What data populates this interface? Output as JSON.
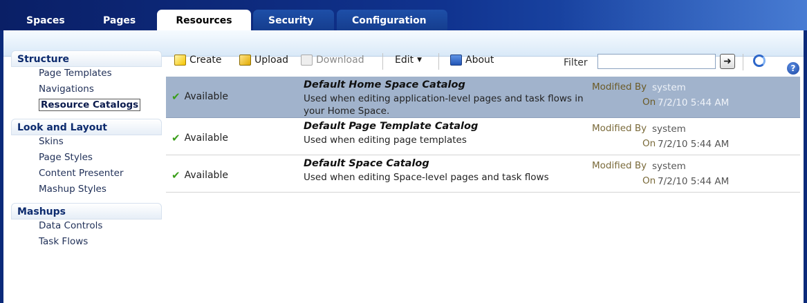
{
  "tabs": [
    {
      "label": "Spaces"
    },
    {
      "label": "Pages"
    },
    {
      "label": "Resources"
    },
    {
      "label": "Security"
    },
    {
      "label": "Configuration"
    }
  ],
  "active_tab": "Resources",
  "help": {
    "icon": "help-icon",
    "glyph": "?"
  },
  "sidebar": {
    "sections": [
      {
        "title": "Structure",
        "items": [
          "Page Templates",
          "Navigations",
          "Resource Catalogs"
        ]
      },
      {
        "title": "Look and Layout",
        "items": [
          "Skins",
          "Page Styles",
          "Content Presenter",
          "Mashup Styles"
        ]
      },
      {
        "title": "Mashups",
        "items": [
          "Data Controls",
          "Task Flows"
        ]
      }
    ],
    "selected_item": "Resource Catalogs"
  },
  "toolbar": {
    "create": "Create",
    "upload": "Upload",
    "download": "Download",
    "edit": "Edit",
    "about": "About",
    "filter_label": "Filter",
    "filter_value": "",
    "go_glyph": "➜"
  },
  "catalogs": [
    {
      "status": "Available",
      "name": "Default Home Space Catalog",
      "description": "Used when editing application-level pages and task flows in your Home Space.",
      "modified_by_label": "Modified By",
      "modified_by": "system",
      "on_label": "On",
      "on": "7/2/10 5:44 AM",
      "selected": true
    },
    {
      "status": "Available",
      "name": "Default Page Template Catalog",
      "description": "Used when editing page templates",
      "modified_by_label": "Modified By",
      "modified_by": "system",
      "on_label": "On",
      "on": "7/2/10 5:44 AM",
      "selected": false
    },
    {
      "status": "Available",
      "name": "Default Space Catalog",
      "description": "Used when editing Space-level pages and task flows",
      "modified_by_label": "Modified By",
      "modified_by": "system",
      "on_label": "On",
      "on": "7/2/10 5:44 AM",
      "selected": false
    }
  ],
  "colors": {
    "selected_row": "#a1b3cc",
    "header_blue": "#0b2a7a",
    "check_green": "#3a9e1a"
  }
}
